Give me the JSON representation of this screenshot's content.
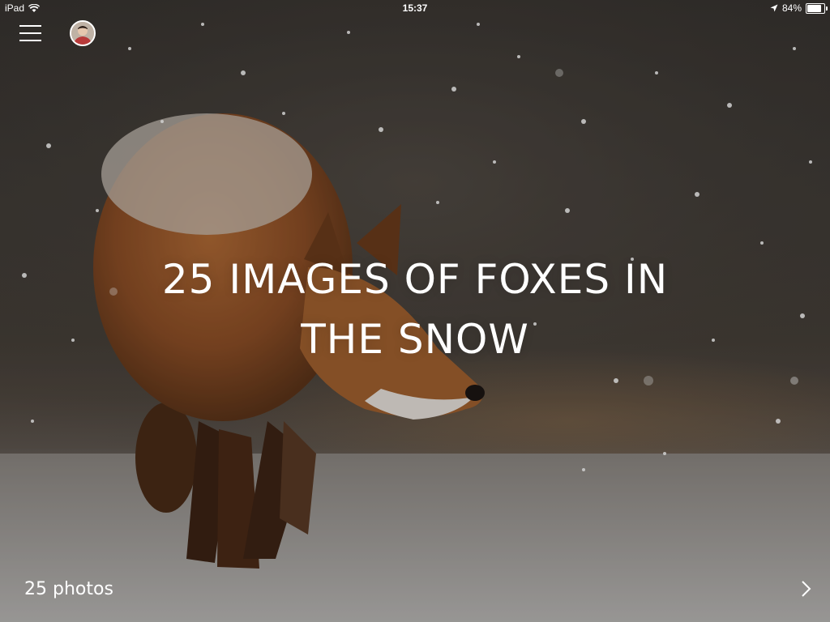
{
  "status_bar": {
    "device": "iPad",
    "time": "15:37",
    "battery_percent": "84%",
    "battery_level": 0.84,
    "icons": [
      "wifi-icon",
      "location-arrow-icon",
      "battery-icon"
    ]
  },
  "header": {
    "menu_icon": "hamburger-menu-icon",
    "avatar_icon": "user-avatar"
  },
  "article": {
    "title_line1": "25 IMAGES OF FOXES IN",
    "title_line2": "THE SNOW",
    "photo_count": "25 photos",
    "next_icon": "chevron-right-icon"
  },
  "colors": {
    "text": "#ffffff",
    "background_dark": "#3a3632",
    "snow_ground": "#b7b5b3",
    "fox_fur": "#9a5a2e"
  }
}
